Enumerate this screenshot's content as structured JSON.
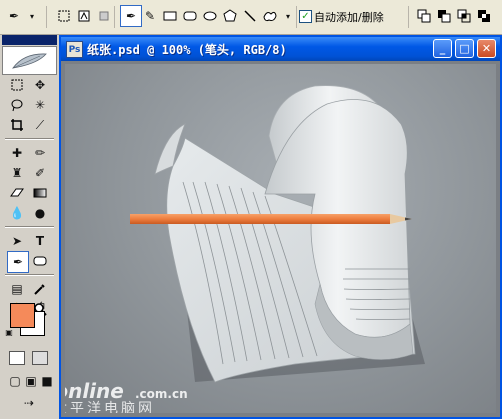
{
  "options_bar": {
    "auto_add_delete_label": "自动添加/删除",
    "auto_add_delete_checked": "✓"
  },
  "document": {
    "title": "纸张.psd @ 100% (笔头, RGB/8)",
    "minimize_label": "_",
    "maximize_label": "□",
    "close_label": "✕",
    "icon_label": "Ps"
  },
  "colors": {
    "foreground": "#f58a5a",
    "background": "#ffffff",
    "titlebar": "#0058e6",
    "canvas": "#8f959a"
  },
  "watermark": {
    "brand": "PConline",
    "domain_suffix": ".com.cn",
    "cn_name": "太平洋电脑网"
  }
}
